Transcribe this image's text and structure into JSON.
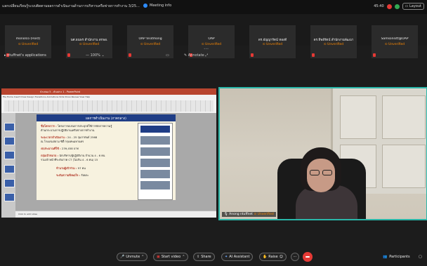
{
  "window": {
    "title": "แลกเปลี่ยนเรียนรู้ระบบติดตามผลการดำเนินงานด้านการบริหารเครือข่ายการทำงาน 3/25...",
    "meeting_info": "Meeting info",
    "timer": "45:40",
    "layout_label": "Layout"
  },
  "participants_strip": [
    {
      "name": "monolco (Host)",
      "status": "Unverified"
    },
    {
      "name": "นศ.ธนพร สำนักงาน สกพอ.",
      "status": "Unverified"
    },
    {
      "name": "OAP Visitmong",
      "status": "Unverified"
    },
    {
      "name": "OAP",
      "status": "Unverified"
    },
    {
      "name": "ดร.อัญญารัตน์ ทองดี",
      "status": "Unverified"
    },
    {
      "name": "ดร.ทิพย์รัตน์ สำนักงานพัฒนา",
      "status": "Unverified"
    },
    {
      "name": "Samsonsitt@OAP",
      "status": "Unverified"
    }
  ],
  "share_bar": {
    "label": "ntuffnet's applications",
    "zoom": "100%",
    "annotate": "Annotate"
  },
  "slide": {
    "window_title": "นำเสนอ 5 - ตัวอย่าง 1 - PowerPoint",
    "ribbon_tabs": "File  Home  Insert  Draw  Design  Transitions  Animations  Slide Show  Review  View  Help",
    "title": "ผลการดำเนินงาน (ภาคกลาง)",
    "lines": [
      {
        "label": "ชื่อโครงการ :",
        "text": "โครงการอบรมการประยุกต์ใช้การจัดการความรู้"
      },
      {
        "label": "",
        "text": "ด้านกระบวนการปฏิบัติงานเครือข่ายการทำงาน"
      },
      {
        "label": "ระยะเวลาดำเนินงาน :",
        "text": "24 - 25 กุมภาพันธ์ 2568"
      },
      {
        "label": "",
        "text": "ณ โรงแรมสยาม ซิตี้ กรุงเทพมหานคร"
      },
      {
        "label": "งบประมาณที่ใช้ :",
        "text": "239,458 บาท"
      },
      {
        "label": "กลุ่มเป้าหมาย :",
        "text": "นักบริหาร/ผู้ปฏิบัติงาน จำนวน 4 - 6 คน"
      },
      {
        "label": "",
        "text": "รวมเจ้าหน้าที่ระดับภาค CT (ไม่เกิน 4 - 6 คน) 15"
      },
      {
        "label": "จำนวนผู้เข้าร่วม :",
        "text": "97 คน"
      },
      {
        "label": "ระดับความพึงพอใจ :",
        "text": "ร้อยละ"
      }
    ],
    "notes": "Click to add notes"
  },
  "speaker": {
    "name": "Anong ntuffnet",
    "status": "Unverified"
  },
  "controls": {
    "unmute": "Unmute",
    "start_video": "Start video",
    "share": "Share",
    "ai_assistant": "AI Assistant",
    "raise": "Raise",
    "participants": "Participants"
  }
}
